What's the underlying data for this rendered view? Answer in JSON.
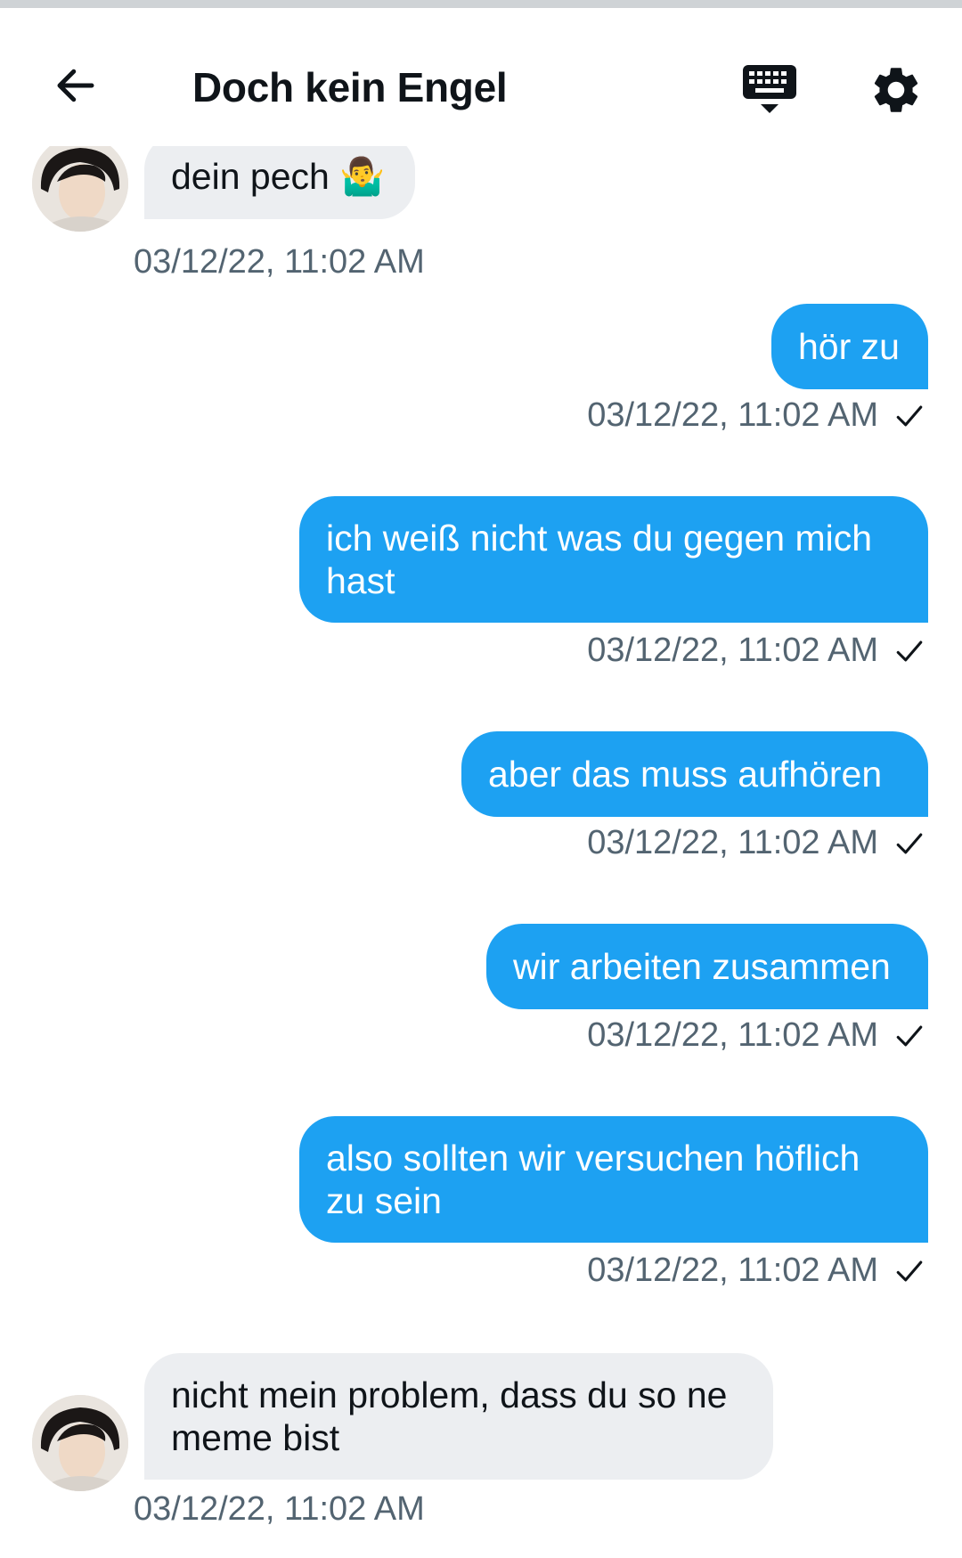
{
  "header": {
    "title": "Doch kein Engel",
    "back_icon": "arrow-left-icon",
    "keyboard_icon": "keyboard-icon",
    "settings_icon": "gear-icon"
  },
  "colors": {
    "sent_bubble": "#1da1f2",
    "received_bubble": "#eceef1",
    "timestamp": "#536471"
  },
  "messages": [
    {
      "direction": "received",
      "text": "dein pech 🤷‍♂️",
      "time": "03/12/22, 11:02 AM"
    },
    {
      "direction": "sent",
      "text": "hör zu",
      "time": "03/12/22, 11:02 AM",
      "status_icon": "checkmark-icon"
    },
    {
      "direction": "sent",
      "text": "ich weiß nicht was du gegen mich hast",
      "time": "03/12/22, 11:02 AM",
      "status_icon": "checkmark-icon"
    },
    {
      "direction": "sent",
      "text": "aber das muss aufhören",
      "time": "03/12/22, 11:02 AM",
      "status_icon": "checkmark-icon"
    },
    {
      "direction": "sent",
      "text": "wir arbeiten zusammen",
      "time": "03/12/22, 11:02 AM",
      "status_icon": "checkmark-icon"
    },
    {
      "direction": "sent",
      "text": "also sollten wir versuchen höflich zu sein",
      "time": "03/12/22, 11:02 AM",
      "status_icon": "checkmark-icon"
    },
    {
      "direction": "received",
      "text": "nicht mein problem, dass du so ne meme bist",
      "time": "03/12/22, 11:02 AM"
    }
  ]
}
